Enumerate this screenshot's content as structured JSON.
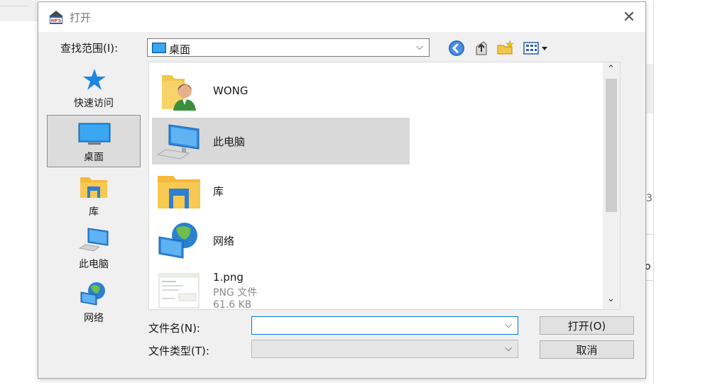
{
  "dialog": {
    "title": "打开",
    "close_glyph": "✕",
    "app_icon": "hfs-app-icon"
  },
  "lookin": {
    "label": "查找范围(I):",
    "value": "桌面"
  },
  "toolbar": {
    "icons": [
      "back-icon",
      "up-folder-icon",
      "new-folder-icon",
      "view-menu-icon"
    ]
  },
  "places": [
    {
      "label": "快速访问",
      "icon": "star-icon"
    },
    {
      "label": "桌面",
      "icon": "desktop-icon",
      "selected": true
    },
    {
      "label": "库",
      "icon": "library-icon"
    },
    {
      "label": "此电脑",
      "icon": "computer-icon"
    },
    {
      "label": "网络",
      "icon": "network-icon"
    }
  ],
  "files": [
    {
      "name": "WONG",
      "icon": "user-folder-icon"
    },
    {
      "name": "此电脑",
      "icon": "computer-icon",
      "selected": true
    },
    {
      "name": "库",
      "icon": "library-icon"
    },
    {
      "name": "网络",
      "icon": "network-icon"
    },
    {
      "name": "1.png",
      "type": "PNG 文件",
      "size": "61.6 KB",
      "icon": "image-thumbnail-icon"
    }
  ],
  "filename": {
    "label": "文件名(N):",
    "value": ""
  },
  "filetype": {
    "label": "文件类型(T):",
    "value": ""
  },
  "buttons": {
    "open": "打开(O)",
    "cancel": "取消"
  },
  "background": {
    "edge_chars": [
      "3",
      "o"
    ]
  }
}
